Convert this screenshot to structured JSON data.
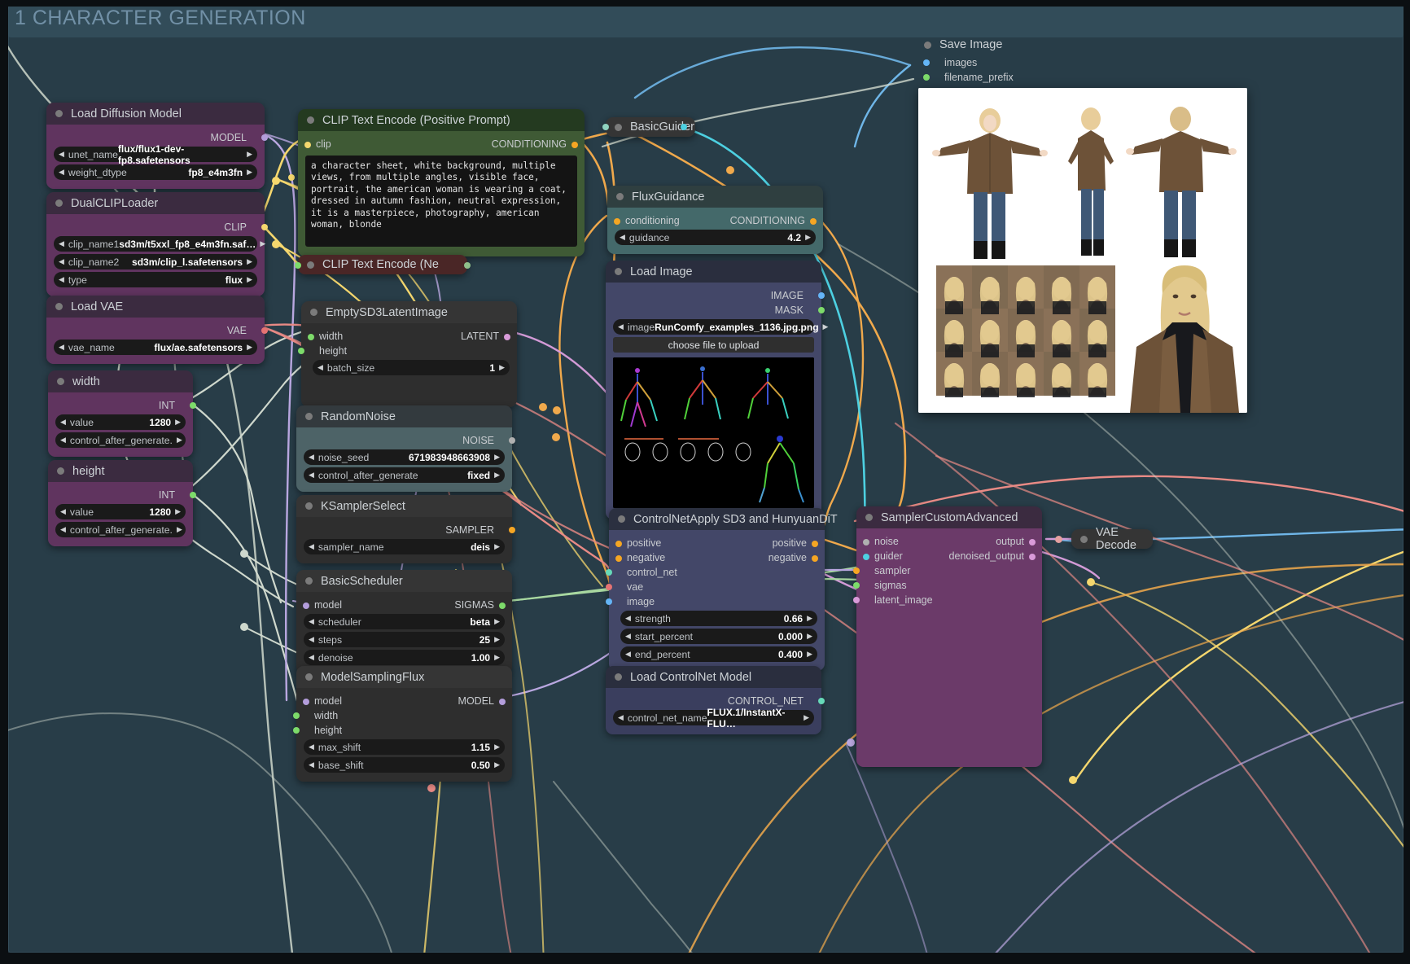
{
  "group": {
    "title": "1 CHARACTER GENERATION"
  },
  "nodes": {
    "load_diffusion_model": {
      "title": "Load Diffusion Model",
      "outputs": [
        {
          "label": "MODEL",
          "color": "#b39ddb"
        }
      ],
      "widgets": [
        {
          "name": "unet_name",
          "value": "flux/flux1-dev-fp8.safetensors"
        },
        {
          "name": "weight_dtype",
          "value": "fp8_e4m3fn"
        }
      ]
    },
    "dual_clip_loader": {
      "title": "DualCLIPLoader",
      "outputs": [
        {
          "label": "CLIP",
          "color": "#f5d76e"
        }
      ],
      "widgets": [
        {
          "name": "clip_name1",
          "value": "sd3m/t5xxl_fp8_e4m3fn.saf…"
        },
        {
          "name": "clip_name2",
          "value": "sd3m/clip_l.safetensors"
        },
        {
          "name": "type",
          "value": "flux"
        }
      ]
    },
    "load_vae": {
      "title": "Load VAE",
      "outputs": [
        {
          "label": "VAE",
          "color": "#e57373"
        }
      ],
      "widgets": [
        {
          "name": "vae_name",
          "value": "flux/ae.safetensors"
        }
      ]
    },
    "width_primitive": {
      "title": "width",
      "outputs": [
        {
          "label": "INT",
          "color": "#7ddb6a"
        }
      ],
      "widgets": [
        {
          "name": "value",
          "value": "1280"
        },
        {
          "name": "control_after_generate.",
          "value": ""
        }
      ]
    },
    "height_primitive": {
      "title": "height",
      "outputs": [
        {
          "label": "INT",
          "color": "#7ddb6a"
        }
      ],
      "widgets": [
        {
          "name": "value",
          "value": "1280"
        },
        {
          "name": "control_after_generate.",
          "value": ""
        }
      ]
    },
    "clip_text_encode_positive": {
      "title": "CLIP Text Encode (Positive Prompt)",
      "inputs": [
        {
          "label": "clip",
          "color": "#f5d76e"
        }
      ],
      "outputs": [
        {
          "label": "CONDITIONING",
          "color": "#f5a623"
        }
      ],
      "text": "a character sheet, white background, multiple views, from multiple angles, visible face, portrait, the american woman is wearing a coat, dressed in autumn fashion, neutral expression, it is a masterpiece, photography, american woman, blonde"
    },
    "clip_text_encode_negative": {
      "title": "CLIP Text Encode (Ne"
    },
    "empty_sd3_latent_image": {
      "title": "EmptySD3LatentImage",
      "inputs": [
        {
          "label": "width",
          "color": "#7ddb6a"
        },
        {
          "label": "height",
          "color": "#7ddb6a"
        }
      ],
      "outputs": [
        {
          "label": "LATENT",
          "color": "#d99bd9"
        }
      ],
      "widgets": [
        {
          "name": "batch_size",
          "value": "1"
        }
      ]
    },
    "random_noise": {
      "title": "RandomNoise",
      "outputs": [
        {
          "label": "NOISE",
          "color": "#b0b0b0"
        }
      ],
      "widgets": [
        {
          "name": "noise_seed",
          "value": "671983948663908"
        },
        {
          "name": "control_after_generate",
          "value": "fixed"
        }
      ]
    },
    "ksampler_select": {
      "title": "KSamplerSelect",
      "outputs": [
        {
          "label": "SAMPLER",
          "color": "#f5a623"
        }
      ],
      "widgets": [
        {
          "name": "sampler_name",
          "value": "deis"
        }
      ]
    },
    "basic_scheduler": {
      "title": "BasicScheduler",
      "inputs": [
        {
          "label": "model",
          "color": "#b39ddb"
        }
      ],
      "outputs": [
        {
          "label": "SIGMAS",
          "color": "#7ddb6a"
        }
      ],
      "widgets": [
        {
          "name": "scheduler",
          "value": "beta"
        },
        {
          "name": "steps",
          "value": "25"
        },
        {
          "name": "denoise",
          "value": "1.00"
        }
      ]
    },
    "model_sampling_flux": {
      "title": "ModelSamplingFlux",
      "inputs": [
        {
          "label": "model",
          "color": "#b39ddb"
        },
        {
          "label": "width",
          "color": "#7ddb6a"
        },
        {
          "label": "height",
          "color": "#7ddb6a"
        }
      ],
      "outputs": [
        {
          "label": "MODEL",
          "color": "#b39ddb"
        }
      ],
      "widgets": [
        {
          "name": "max_shift",
          "value": "1.15"
        },
        {
          "name": "base_shift",
          "value": "0.50"
        }
      ]
    },
    "basic_guider": {
      "title": "BasicGuider"
    },
    "flux_guidance": {
      "title": "FluxGuidance",
      "inputs": [
        {
          "label": "conditioning",
          "color": "#f5a623"
        }
      ],
      "outputs": [
        {
          "label": "CONDITIONING",
          "color": "#f5a623"
        }
      ],
      "widgets": [
        {
          "name": "guidance",
          "value": "4.2"
        }
      ]
    },
    "load_image": {
      "title": "Load Image",
      "outputs": [
        {
          "label": "IMAGE",
          "color": "#64b5f6"
        },
        {
          "label": "MASK",
          "color": "#7ddb6a"
        }
      ],
      "widgets": [
        {
          "name": "image",
          "value": "RunComfy_examples_1136.jpg.png"
        }
      ],
      "upload_label": "choose file to upload"
    },
    "controlnet_apply": {
      "title": "ControlNetApply SD3 and HunyuanDiT",
      "inputs": [
        {
          "label": "positive",
          "color": "#f5a623"
        },
        {
          "label": "negative",
          "color": "#f5a623"
        },
        {
          "label": "control_net",
          "color": "#66d9b8"
        },
        {
          "label": "vae",
          "color": "#e57373"
        },
        {
          "label": "image",
          "color": "#64b5f6"
        }
      ],
      "outputs": [
        {
          "label": "positive",
          "color": "#f5a623"
        },
        {
          "label": "negative",
          "color": "#f5a623"
        }
      ],
      "widgets": [
        {
          "name": "strength",
          "value": "0.66"
        },
        {
          "name": "start_percent",
          "value": "0.000"
        },
        {
          "name": "end_percent",
          "value": "0.400"
        }
      ]
    },
    "load_controlnet_model": {
      "title": "Load ControlNet Model",
      "outputs": [
        {
          "label": "CONTROL_NET",
          "color": "#66d9b8"
        }
      ],
      "widgets": [
        {
          "name": "control_net_name",
          "value": "FLUX.1/InstantX-FLU…"
        }
      ]
    },
    "sampler_custom_advanced": {
      "title": "SamplerCustomAdvanced",
      "inputs": [
        {
          "label": "noise",
          "color": "#b0b0b0"
        },
        {
          "label": "guider",
          "color": "#4dd0e1"
        },
        {
          "label": "sampler",
          "color": "#f5a623"
        },
        {
          "label": "sigmas",
          "color": "#7ddb6a"
        },
        {
          "label": "latent_image",
          "color": "#d99bd9"
        }
      ],
      "outputs": [
        {
          "label": "output",
          "color": "#d99bd9"
        },
        {
          "label": "denoised_output",
          "color": "#d99bd9"
        }
      ]
    },
    "vae_decode": {
      "title": "VAE Decode"
    },
    "save_image": {
      "title": "Save Image",
      "inputs": [
        {
          "label": "images",
          "color": "#64b5f6"
        },
        {
          "label": "filename_prefix",
          "color": "#7ddb6a"
        }
      ]
    }
  },
  "colors": {
    "canvas_bg": "#24343c",
    "group_bg": "#2c4652",
    "group_title": "#7d9cb4",
    "node_body_purple": "#60345f",
    "node_body_green": "#3f5a35",
    "node_body_grey": "#2e2e2e",
    "node_body_teal": "#3d5b5c",
    "node_body_navy": "#3a3e5e",
    "node_body_plum": "#6b3a69",
    "accent_orange": "#f5a623",
    "accent_cyan": "#4dd0e1",
    "accent_yellow": "#f5d76e"
  }
}
